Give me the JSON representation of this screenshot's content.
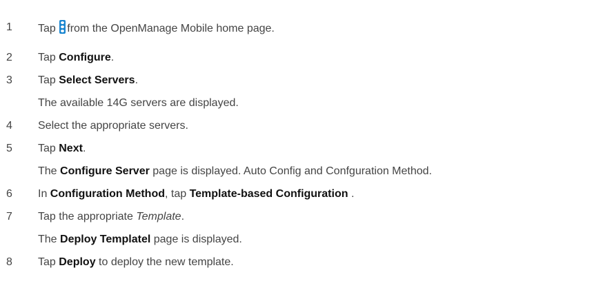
{
  "steps": [
    {
      "num": "1",
      "t1": "Tap",
      "icon": "kebab-menu-icon",
      "t2": "from the OpenManage Mobile home page."
    },
    {
      "num": "2",
      "t1": "Tap ",
      "b1": "Configure",
      "t2": "."
    },
    {
      "num": "3",
      "t1": "Tap ",
      "b1": "Select Servers",
      "t2": ".",
      "note": "The available 14G servers are displayed."
    },
    {
      "num": "4",
      "t1": "Select the appropriate servers."
    },
    {
      "num": "5",
      "t1": "Tap ",
      "b1": "Next",
      "t2": ".",
      "note_t1": "The ",
      "note_b1": "Configure Server",
      "note_t2": " page is displayed. Auto Config and Confguration Method."
    },
    {
      "num": "6",
      "t1": "In ",
      "b1": "Configuration Method",
      "t2": ", tap ",
      "b2": "Template-based Configuration",
      "t3": " ."
    },
    {
      "num": "7",
      "t1": "Tap the appropriate ",
      "i1": "Template",
      "t2": ".",
      "note_t1": "The ",
      "note_b1": "Deploy Templatel",
      "note_t2": " page is displayed."
    },
    {
      "num": "8",
      "t1": "Tap ",
      "b1": "Deploy",
      "t2": " to deploy the new template."
    }
  ]
}
